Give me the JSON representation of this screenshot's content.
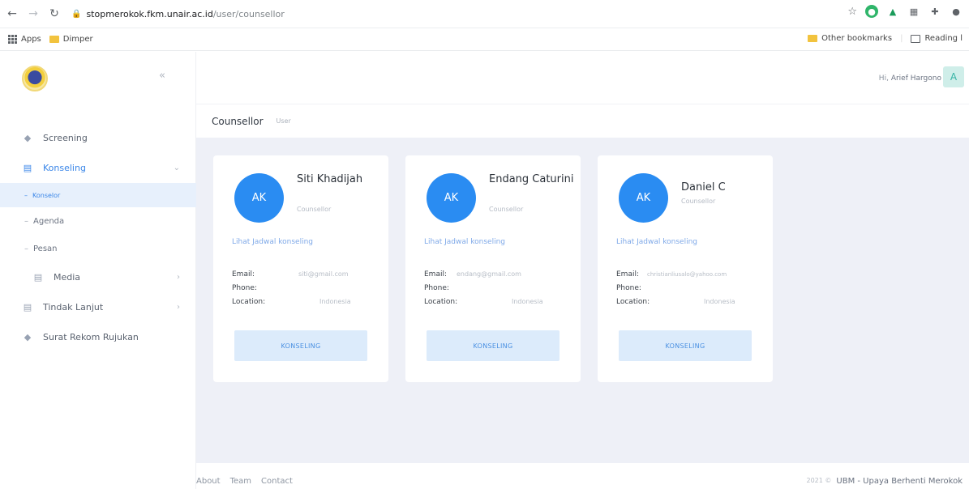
{
  "browser": {
    "url_host": "stopmerokok.fkm.unair.ac.id",
    "url_path": "/user/counsellor",
    "bookmarks": {
      "apps": "Apps",
      "dimper": "Dimper"
    },
    "bookmarks_right": {
      "other": "Other bookmarks",
      "reading": "Reading l"
    }
  },
  "sidebar": {
    "items": {
      "screening": "Screening",
      "konseling": "Konseling",
      "counsellor": "Konselor",
      "agenda": "Agenda",
      "pesan": "Pesan",
      "media": "Media",
      "tindak_lanjut": "Tindak Lanjut",
      "surat": "Surat Rekom Rujukan"
    }
  },
  "header": {
    "greeting": "Hi,",
    "user_name": "Arief Hargono",
    "avatar_initial": "A"
  },
  "subheader": {
    "title": "Counsellor",
    "sub": "User"
  },
  "cards": [
    {
      "initials": "AK",
      "name": "Siti Khadijah",
      "role": "Counsellor",
      "link": "Lihat Jadwal konseling",
      "email_label": "Email:",
      "email": "siti@gmail.com",
      "phone_label": "Phone:",
      "location_label": "Location:",
      "location": "Indonesia",
      "button": "KONSELING"
    },
    {
      "initials": "AK",
      "name": "Endang Caturini",
      "role": "Counsellor",
      "link": "Lihat Jadwal konseling",
      "email_label": "Email:",
      "email": "endang@gmail.com",
      "phone_label": "Phone:",
      "location_label": "Location:",
      "location": "Indonesia",
      "button": "KONSELING"
    },
    {
      "initials": "AK",
      "name": "Daniel C",
      "role": "Counsellor",
      "link": "Lihat Jadwal konseling",
      "email_label": "Email:",
      "email": "christianliusalo@yahoo.com",
      "phone_label": "Phone:",
      "location_label": "Location:",
      "location": "Indonesia",
      "button": "KONSELING"
    }
  ],
  "footer": {
    "about": "About",
    "team": "Team",
    "contact": "Contact",
    "year": "2021 ©",
    "brand": "UBM - Upaya Berhenti Merokok"
  }
}
